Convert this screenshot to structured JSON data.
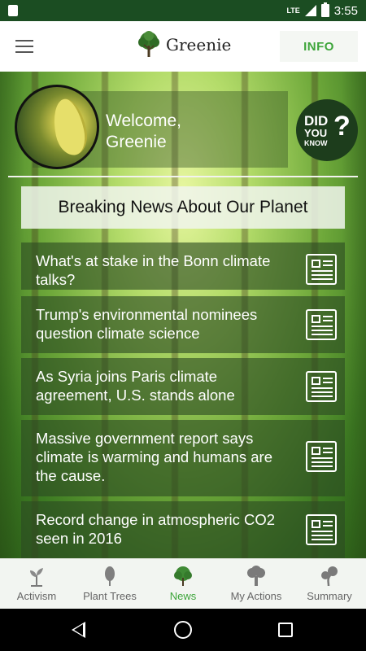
{
  "status_bar": {
    "network": "LTE",
    "time": "3:55"
  },
  "app_bar": {
    "brand_name": "Greenie",
    "info_label": "INFO"
  },
  "welcome": {
    "line1": "Welcome,",
    "line2": "Greenie"
  },
  "did_you_know": {
    "line1": "DID",
    "line2": "YOU",
    "line3": "KNOW",
    "mark": "?"
  },
  "news": {
    "header": "Breaking News About Our Planet",
    "items": [
      {
        "title": "What's at stake in the Bonn climate talks?"
      },
      {
        "title": "Trump's environmental nominees question climate science"
      },
      {
        "title": "As Syria joins Paris climate agreement, U.S. stands alone"
      },
      {
        "title": "Massive government report says climate is warming and humans are the cause."
      },
      {
        "title": "Record change in atmospheric CO2 seen in 2016"
      }
    ]
  },
  "bottom_nav": {
    "items": [
      {
        "label": "Activism",
        "icon": "sprout-icon"
      },
      {
        "label": "Plant Trees",
        "icon": "tree-icon"
      },
      {
        "label": "News",
        "icon": "tree-round-icon"
      },
      {
        "label": "My Actions",
        "icon": "oak-icon"
      },
      {
        "label": "Summary",
        "icon": "bonsai-icon"
      }
    ],
    "active": "News"
  },
  "colors": {
    "status_bar": "#1b4d22",
    "accent": "#3da53a",
    "news_panel": "#2c4a22",
    "dyk_badge": "#1d3d1c"
  }
}
